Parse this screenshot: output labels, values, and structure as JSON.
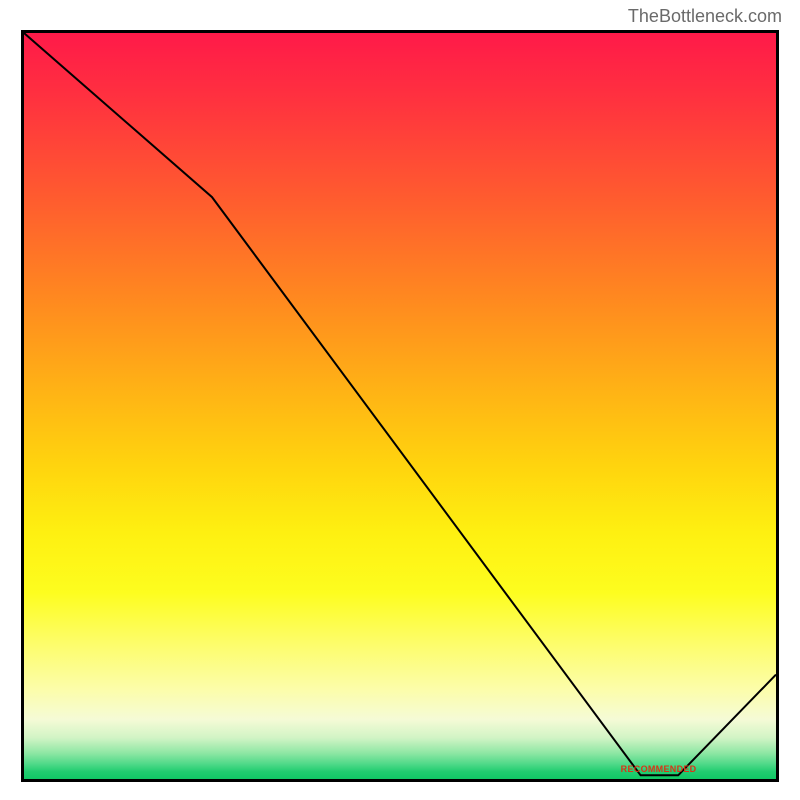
{
  "watermark": "TheBottleneck.com",
  "chart_data": {
    "type": "line",
    "title": "",
    "xlabel": "",
    "ylabel": "",
    "xlim": [
      0,
      100
    ],
    "ylim": [
      0,
      100
    ],
    "x": [
      0,
      25,
      82,
      87,
      100
    ],
    "values": [
      100,
      78,
      0.5,
      0.5,
      14
    ],
    "annotations": [
      {
        "text": "RECOMMENDED",
        "x": 84,
        "y": 1
      }
    ]
  }
}
